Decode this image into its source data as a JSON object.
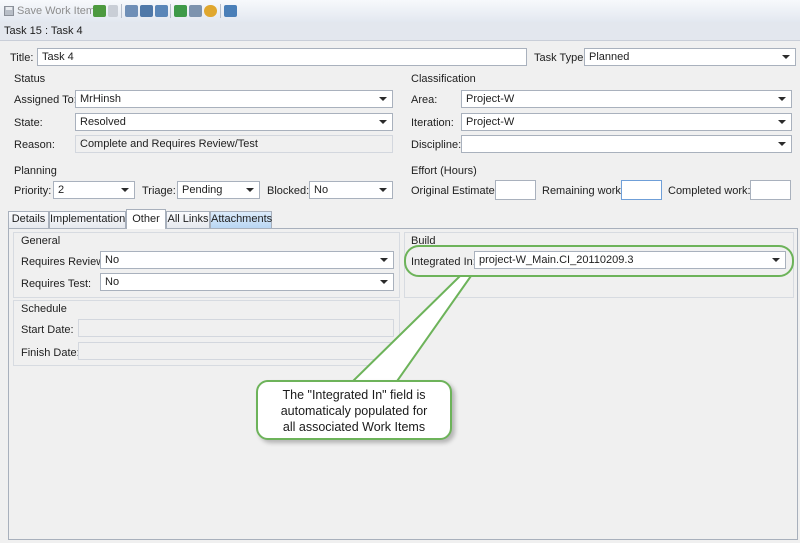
{
  "toolbar": {
    "save_label": "Save Work Item"
  },
  "window": {
    "title": "Task 15 : Task 4"
  },
  "header": {
    "title_label": "Title:",
    "title_value": "Task 4",
    "task_type_label": "Task Type:",
    "task_type_value": "Planned"
  },
  "status": {
    "heading": "Status",
    "assigned_to_label": "Assigned To:",
    "assigned_to_value": "MrHinsh",
    "state_label": "State:",
    "state_value": "Resolved",
    "reason_label": "Reason:",
    "reason_value": "Complete and Requires Review/Test"
  },
  "classification": {
    "heading": "Classification",
    "area_label": "Area:",
    "area_value": "Project-W",
    "iteration_label": "Iteration:",
    "iteration_value": "Project-W",
    "discipline_label": "Discipline:",
    "discipline_value": ""
  },
  "planning": {
    "heading": "Planning",
    "priority_label": "Priority:",
    "priority_value": "2",
    "triage_label": "Triage:",
    "triage_value": "Pending",
    "blocked_label": "Blocked:",
    "blocked_value": "No"
  },
  "effort": {
    "heading": "Effort (Hours)",
    "original_label": "Original Estimate:",
    "original_value": "",
    "remaining_label": "Remaining work:",
    "remaining_value": "",
    "completed_label": "Completed work:",
    "completed_value": ""
  },
  "tabs": [
    {
      "label": "Details"
    },
    {
      "label": "Implementation"
    },
    {
      "label": "Other",
      "active": true
    },
    {
      "label": "All Links"
    },
    {
      "label": "Attachments"
    }
  ],
  "other_tab": {
    "general_heading": "General",
    "requires_review_label": "Requires Review:",
    "requires_review_value": "No",
    "requires_test_label": "Requires Test:",
    "requires_test_value": "No",
    "build_heading": "Build",
    "integrated_in_label": "Integrated In:",
    "integrated_in_value": "project-W_Main.CI_20110209.3",
    "schedule_heading": "Schedule",
    "start_date_label": "Start Date:",
    "start_date_value": "",
    "finish_date_label": "Finish Date:",
    "finish_date_value": ""
  },
  "callout": {
    "line1": "The \"Integrated In\" field is",
    "line2": "automaticaly populated for",
    "line3": "all associated Work Items"
  },
  "colors": {
    "highlight_green": "#6db35a",
    "tab_blue": "#b9d6f3"
  }
}
